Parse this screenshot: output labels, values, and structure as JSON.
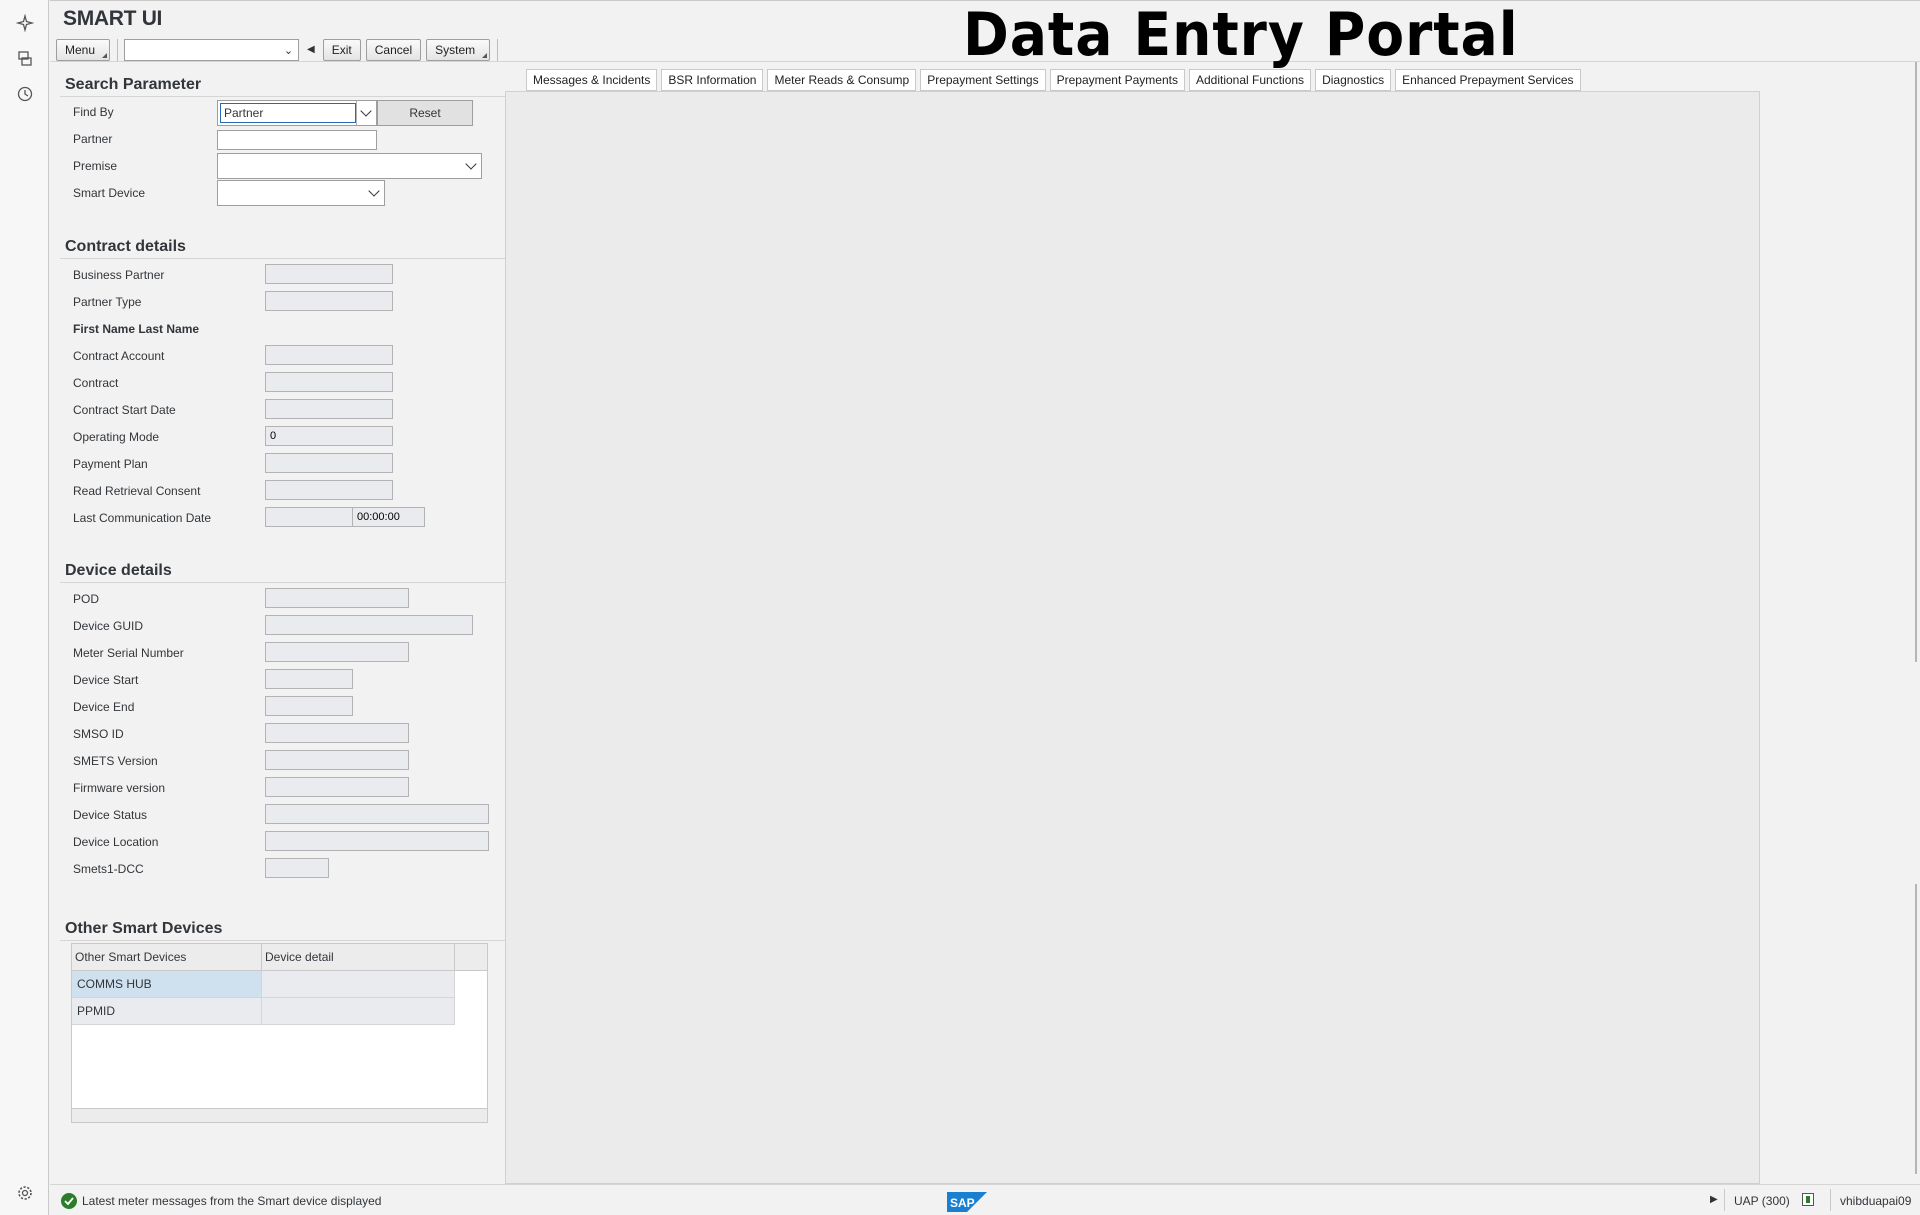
{
  "app": {
    "title": "SMART UI",
    "banner": "Data Entry Portal"
  },
  "toolbar": {
    "menu_label": "Menu",
    "command_value": "",
    "exit_label": "Exit",
    "cancel_label": "Cancel",
    "system_label": "System"
  },
  "search": {
    "title": "Search Parameter",
    "find_by_label": "Find By",
    "find_by_value": "Partner",
    "reset_label": "Reset",
    "partner_label": "Partner",
    "partner_value": "",
    "premise_label": "Premise",
    "smart_device_label": "Smart Device"
  },
  "contract": {
    "title": "Contract details",
    "business_partner": "Business Partner",
    "partner_type": "Partner Type",
    "name_heading": "First Name Last Name",
    "contract_account": "Contract Account",
    "contract": "Contract",
    "contract_start_date": "Contract Start Date",
    "operating_mode": "Operating Mode",
    "operating_mode_value": "0",
    "payment_plan": "Payment Plan",
    "read_retrieval_consent": "Read Retrieval Consent",
    "last_communication_date": "Last Communication Date",
    "last_communication_time": "00:00:00"
  },
  "device": {
    "title": "Device details",
    "pod": "POD",
    "device_guid": "Device GUID",
    "meter_serial_number": "Meter Serial Number",
    "device_start": "Device Start",
    "device_end": "Device End",
    "smso_id": "SMSO ID",
    "smets_version": "SMETS Version",
    "firmware_version": "Firmware version",
    "device_status": "Device Status",
    "device_location": "Device Location",
    "smets1_dcc": "Smets1-DCC"
  },
  "other_devices": {
    "title": "Other Smart Devices",
    "columns": [
      "Other Smart Devices",
      "Device detail"
    ],
    "rows": [
      {
        "device": "COMMS HUB",
        "detail": ""
      },
      {
        "device": "PPMID",
        "detail": ""
      }
    ]
  },
  "tabs": [
    {
      "label": "Messages & Incidents"
    },
    {
      "label": "BSR Information"
    },
    {
      "label": "Meter Reads & Consump"
    },
    {
      "label": "Prepayment Settings"
    },
    {
      "label": "Prepayment Payments"
    },
    {
      "label": "Additional Functions"
    },
    {
      "label": "Diagnostics"
    },
    {
      "label": "Enhanced Prepayment Services"
    }
  ],
  "status": {
    "message": "Latest meter messages from the Smart device displayed",
    "system": "UAP (300)",
    "user": "vhibduapai09"
  },
  "colors": {
    "accent": "#2a68b3",
    "ok": "#2b7d2b",
    "sap_blue": "#1a7fd0"
  },
  "icons": [
    "sparkle-icon",
    "transaction-icon",
    "history-icon",
    "settings-icon",
    "check-icon",
    "sap-logo"
  ]
}
